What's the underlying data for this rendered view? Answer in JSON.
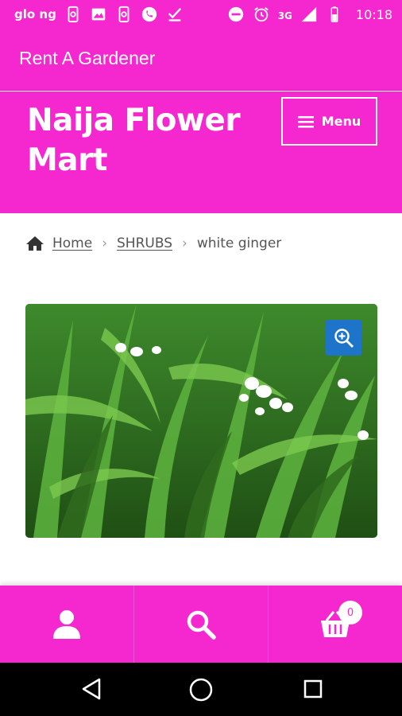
{
  "status_bar": {
    "carrier": "glo ng",
    "network": "3G",
    "time": "10:18",
    "icons": [
      "screenshot-icon",
      "image-icon",
      "screenshot-icon",
      "whatsapp-icon",
      "download-done-icon",
      "dnd-icon",
      "alarm-icon",
      "signal-icon",
      "battery-icon"
    ]
  },
  "top_bar": {
    "title": "Rent A Gardener"
  },
  "header": {
    "site_title": "Naija Flower Mart",
    "menu_label": "Menu"
  },
  "breadcrumb": {
    "home": "Home",
    "category": "SHRUBS",
    "current": "white ginger"
  },
  "product": {
    "image_alt": "white ginger plant"
  },
  "bottom_bar": {
    "items": [
      "account-icon",
      "search-icon",
      "cart-icon"
    ],
    "cart_count": "0"
  },
  "colors": {
    "brand_pink": "#f528d0",
    "zoom_blue": "#1e74c8"
  }
}
